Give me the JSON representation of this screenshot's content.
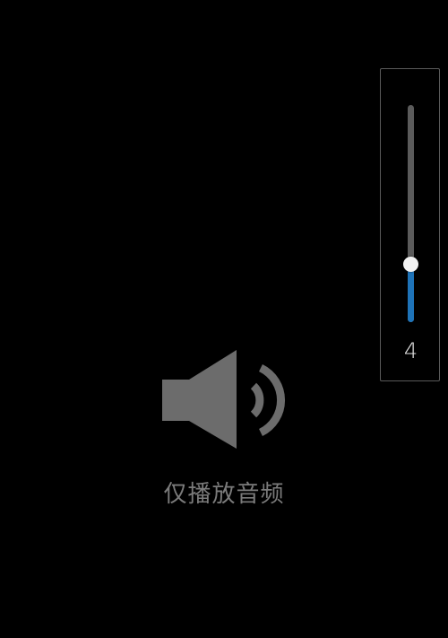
{
  "volume": {
    "value": "4",
    "level_fraction": 0.27,
    "track_color": "#5b5b5b",
    "fill_color": "#1e73b8",
    "thumb_color": "#f2f2f2"
  },
  "center": {
    "icon": "speaker-sound-icon",
    "icon_color": "#6c6c6c",
    "label": "仅播放音频",
    "label_color": "#7b7b7b"
  }
}
